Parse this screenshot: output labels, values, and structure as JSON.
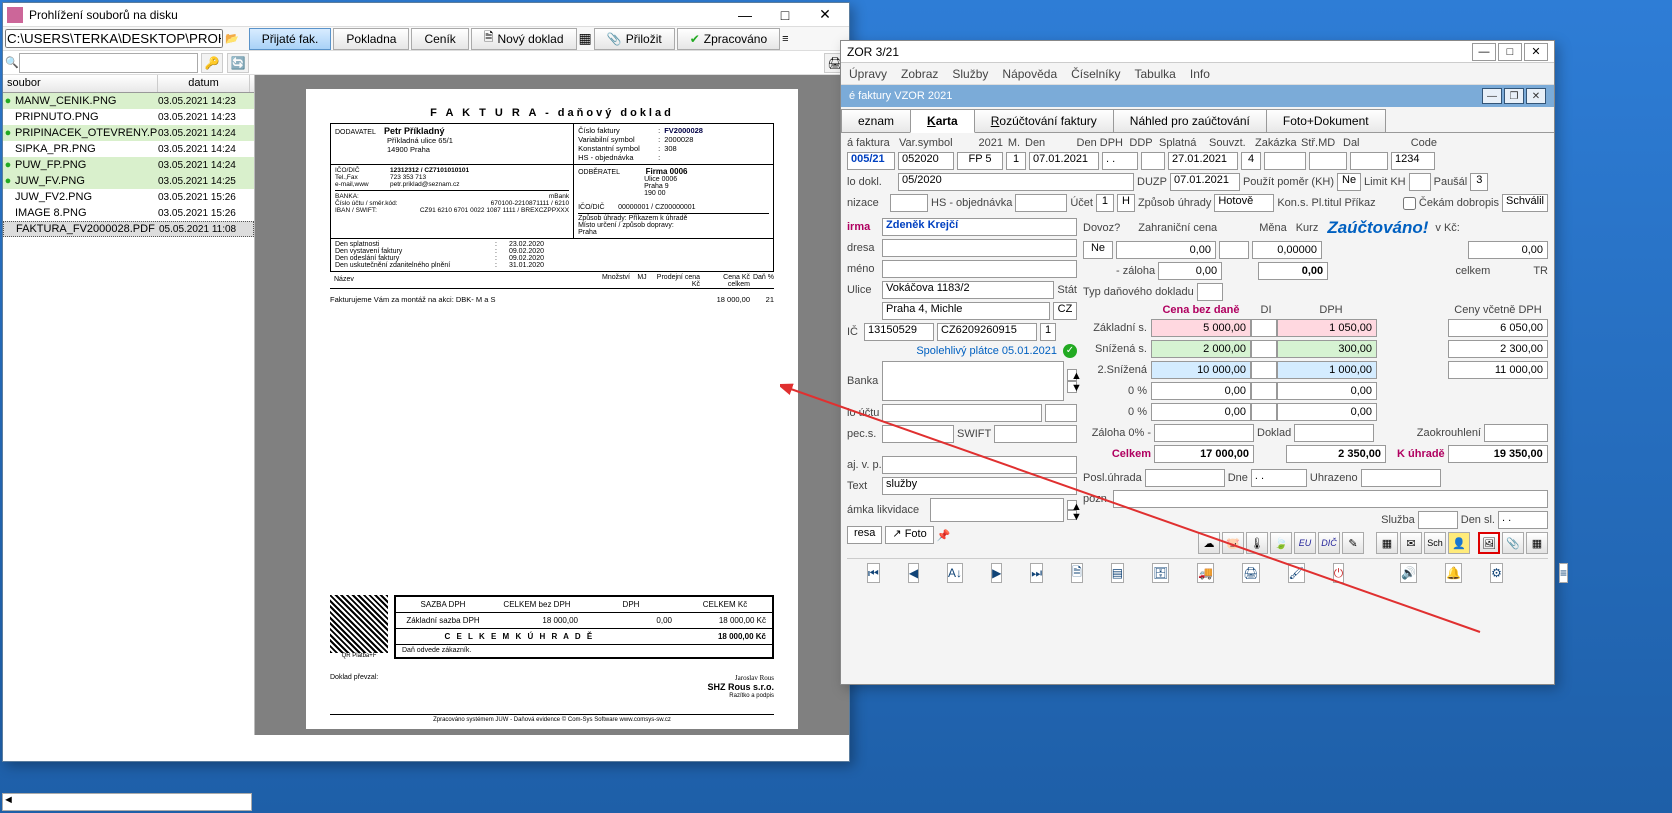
{
  "left_window": {
    "title": "Prohlížení souborů na disku",
    "path": "C:\\USERS\\TERKA\\DESKTOP\\PROHLIZENI_PRILC",
    "toolbar": {
      "prijate": "Přijaté fak.",
      "pokladna": "Pokladna",
      "cenik": "Ceník",
      "novy": "Nový doklad",
      "prilozit": "Přiložit",
      "zprac": "Zpracováno"
    },
    "list_headers": {
      "file": "soubor",
      "date": "datum"
    },
    "files": [
      {
        "dot": true,
        "name": "MANW_CENIK.PNG",
        "date": "03.05.2021 14:23",
        "cls": "green"
      },
      {
        "dot": false,
        "name": "PRIPNUTO.PNG",
        "date": "03.05.2021 14:23",
        "cls": ""
      },
      {
        "dot": true,
        "name": "PRIPINACEK_OTEVRENY.PN",
        "date": "03.05.2021 14:24",
        "cls": "green"
      },
      {
        "dot": false,
        "name": "SIPKA_PR.PNG",
        "date": "03.05.2021 14:24",
        "cls": ""
      },
      {
        "dot": true,
        "name": "PUW_FP.PNG",
        "date": "03.05.2021 14:24",
        "cls": "green"
      },
      {
        "dot": true,
        "name": "JUW_FV.PNG",
        "date": "03.05.2021 14:25",
        "cls": "green"
      },
      {
        "dot": false,
        "name": "JUW_FV2.PNG",
        "date": "03.05.2021 15:26",
        "cls": ""
      },
      {
        "dot": false,
        "name": "IMAGE 8.PNG",
        "date": "03.05.2021 15:26",
        "cls": ""
      },
      {
        "dot": false,
        "name": "FAKTURA_FV2000028.PDF",
        "date": "05.05.2021 11:08",
        "cls": "sel"
      }
    ]
  },
  "invoice_doc": {
    "title": "F A K T U R A - daňový doklad",
    "supplier_label": "DODAVATEL",
    "supplier_name": "Petr Příkladný",
    "supplier_addr1": "Příkladná ulice 65/1",
    "supplier_addr2": "14900 Praha",
    "inv_no_lbl": "Číslo faktury",
    "inv_no": "FV2000028",
    "vs_lbl": "Variabilní symbol",
    "vs": "2000028",
    "ks_lbl": "Konstantní symbol",
    "ks": "308",
    "hs_lbl": "HS - objednávka",
    "icodic_lbl": "IČO/DIČ",
    "icodic": "12312312 / CZ7101010101",
    "telfax_lbl": "Tel.,Fax",
    "telfax": "723 353 713",
    "email_lbl": "e-mail,www",
    "email": "petr.priklad@seznam.cz",
    "bank_lbl": "BANKA:",
    "bank": "mBank",
    "acct_lbl": "Číslo účtu / směr.kód:",
    "acct": "670100-2210871111 / 6210",
    "iban_lbl": "IBAN / SWIFT:",
    "iban": "CZ91 6210 6701 0022 1087 1111 / BREXCZPPXXX",
    "recip_lbl": "ODBĚRATEL",
    "recip_name": "Firma 0006",
    "recip_addr1": "Ulice 0006",
    "recip_addr2": "Praha 9",
    "recip_addr3": "190 00",
    "recip_ico_lbl": "IČO/DIČ",
    "recip_ico": "00000001 / CZ00000001",
    "pay_lbl": "Způsob úhrady:  Příkazem k úhradě",
    "deliv_lbl": "Místo určení / způsob dopravy:",
    "deliv_city": "Praha",
    "due_lbl": "Den splatnosti",
    "due": "23.02.2020",
    "issue_lbl": "Den vystavení faktury",
    "issue": "09.02.2020",
    "send_lbl": "Den odeslání faktury",
    "send": "09.02.2020",
    "duzp_lbl": "Den uskutečnění zdanitelného plnění",
    "duzp": "31.01.2020",
    "col_name": "Název",
    "col_qty": "Množství",
    "col_mj": "MJ",
    "col_price": "Prodejní cena Kč",
    "col_total": "Cena Kč celkem",
    "col_tax": "Daň %",
    "item_text": "Fakturujeme Vám za montáž na akci: DBK- M a S",
    "item_total": "18 000,00",
    "item_tax": "21",
    "sum_hdr_rate": "SAZBA DPH",
    "sum_hdr_base": "CELKEM bez DPH",
    "sum_hdr_dph": "DPH",
    "sum_hdr_tot": "CELKEM Kč",
    "sum_rate": "Základní sazba DPH",
    "sum_base": "18 000,00",
    "sum_dph": "0,00",
    "sum_tot": "18 000,00  Kč",
    "sum_final_lbl": "C E L K E M   K   Ú H R A D Ě",
    "sum_final": "18 000,00  Kč",
    "sum_note": "Daň odvede zákazník.",
    "qr_lbl": "QR Platba+F",
    "stamp_co": "SHZ Rous s.r.o.",
    "stamp_sig": "Jaroslav Rous",
    "stamp_note": "Razítko a podpis",
    "prevzal": "Doklad převzal:",
    "foot": "Zpracováno systémem JUW - Daňová evidence   © Com-Sys Software    www.comsys-sw.cz"
  },
  "right_window": {
    "title_suffix": "ZOR 3/21",
    "menu": [
      "Úpravy",
      "Zobraz",
      "Služby",
      "Nápověda",
      "Číselníky",
      "Tabulka",
      "Info"
    ],
    "subtitle": "é faktury VZOR  2021",
    "tabs": {
      "seznam": "eznam",
      "karta": "Karta",
      "roz": "Rozúčtování faktury",
      "nahled": "Náhled pro zaúčtování",
      "foto": "Foto+Dokument"
    },
    "hdr": {
      "faktura": "á faktura",
      "vs": "Var.symbol",
      "rok": "2021",
      "m": "M.",
      "den": "Den",
      "dendph": "Den DPH",
      "ddp": "DDP",
      "splatna": "Splatná",
      "souvzt": "Souvzt.",
      "zakazka": "Zakázka",
      "strmd": "Stř.MD",
      "dal": "Dal",
      "code": "Code"
    },
    "vals": {
      "faktura": "005/21",
      "vs": "052020",
      "fp": "FP   5",
      "m": "1",
      "den": "07.01.2021",
      "dendph": ". .",
      "splatna": "27.01.2021",
      "souvzt": "4",
      "code": "1234",
      "dokl_lbl": "lo dokl.",
      "dokl": "05/2020",
      "duzp_lbl": "DUZP",
      "duzp": "07.01.2021",
      "pomer_lbl": "Použít poměr (KH)",
      "pomer": "Ne",
      "limit_lbl": "Limit KH",
      "pausal_lbl": "Paušál",
      "pausal": "3",
      "org_lbl": "nizace",
      "hs_lbl": "HS - objednávka",
      "ucet_lbl": "Účet",
      "ucet": "1",
      "ucetH": "H",
      "zpu_lbl": "Způsob úhrady",
      "zpu": "Hotově",
      "kons_lbl": "Kon.s.",
      "pltitul": "Pl.titul",
      "prikaz": "Příkaz",
      "dobropis": "Čekám dobropis",
      "schvalil": "Schválil"
    },
    "firma": {
      "firma_lbl": "irma",
      "firma": "Zdeněk Krejčí",
      "adresa_lbl": "dresa",
      "meno_lbl": "méno",
      "ulice_lbl": "Ulice",
      "ulice": "Vokáčova 1183/2",
      "stat_lbl": "Stát",
      "mesto": "Praha 4, Michle",
      "cz": "CZ",
      "ic_lbl": "IČ",
      "ic": "13150529",
      "dic": "CZ6209260915",
      "one": "1",
      "platce": "Spolehlivý plátce 05.01.2021",
      "banka_lbl": "Banka",
      "ucet_lbl": "lo účtu",
      "specs_lbl": "pec.s.",
      "swift": "SWIFT",
      "ajvp": "aj. v. p.",
      "text_lbl": "Text",
      "text": "služby",
      "likv": "ámka likvidace",
      "pozn": "pozn.",
      "adresa_btn": "resa",
      "foto_btn": "Foto"
    },
    "amounts": {
      "dovoz": "Dovoz?",
      "ne": "Ne",
      "zahr": "Zahraniční cena",
      "zahr_v": "0,00",
      "mena": "Měna",
      "kurz": "Kurz",
      "kurz_v": "0,00000",
      "vkc": "v Kč:",
      "vkc_v": "0,00",
      "zaloha": "- záloha",
      "zaloha_v": "0,00",
      "zaloha2": "0,00",
      "celkem_lbl": "celkem",
      "tr": "TR",
      "typdd": "Typ daňového dokladu",
      "cbd": "Cena bez daně",
      "di": "DI",
      "dph": "DPH",
      "cvd": "Ceny včetně DPH",
      "r1_lbl": "Základní s.",
      "r1_b": "5 000,00",
      "r1_d": "1 050,00",
      "r1_t": "6 050,00",
      "r2_lbl": "Snížená s.",
      "r2_b": "2 000,00",
      "r2_d": "300,00",
      "r2_t": "2 300,00",
      "r3_lbl": "2.Snížená",
      "r3_b": "10 000,00",
      "r3_d": "1 000,00",
      "r3_t": "11 000,00",
      "r4_lbl": "0 %",
      "r4_b": "0,00",
      "r4_d": "0,00",
      "r5_lbl": "0 %",
      "r5_b": "0,00",
      "r5_d": "0,00",
      "zal0": "Záloha 0% -",
      "dokl": "Doklad",
      "zaok": "Zaokrouhlení",
      "celk": "Celkem",
      "celk_b": "17 000,00",
      "celk_d": "2 350,00",
      "kuhr": "K úhradě",
      "kuhr_v": "19 350,00",
      "posl": "Posl.úhrada",
      "dne": "Dne",
      "dne_v": ".  .",
      "uhraz": "Uhrazeno",
      "sluzba": "Služba",
      "densl": "Den sl.",
      "densl_v": ".  .",
      "sch": "Sch",
      "eu": "EU",
      "dic_b": "DIČ"
    },
    "stamp": "Zaúčtováno!"
  }
}
